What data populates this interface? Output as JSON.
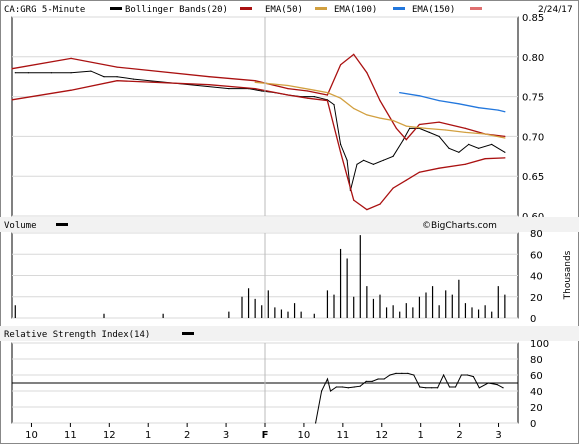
{
  "header": {
    "symbol_label": "CA:GRG 5-Minute",
    "legend": [
      {
        "label": "Bollinger Bands(20)",
        "color": "#000000",
        "swatch": "black-bar"
      },
      {
        "label": "EMA(50)",
        "color": "#aa1111",
        "swatch": "red-bar"
      },
      {
        "label": "EMA(100)",
        "color": "#d2a040",
        "swatch": "gold-bar"
      },
      {
        "label": "EMA(150)",
        "color": "#2277dd",
        "swatch": "blue-bar"
      }
    ],
    "trailing_swatch_color": "#e07070",
    "date": "2/24/17"
  },
  "volume_panel": {
    "label": "Volume",
    "watermark": "©BigCharts.com",
    "unit": "Thousands"
  },
  "rsi_panel": {
    "label": "Relative Strength Index(14)"
  },
  "x_axis_labels": [
    "10",
    "11",
    "12",
    "1",
    "2",
    "3",
    "F",
    "10",
    "11",
    "12",
    "1",
    "2",
    "3"
  ],
  "chart_data": [
    {
      "type": "line",
      "title": "CA:GRG 5-Minute",
      "ylim": [
        0.6,
        0.85
      ],
      "y_ticks": [
        0.85,
        0.8,
        0.75,
        0.7,
        0.65,
        0.6
      ],
      "x": [
        0,
        1,
        2,
        3,
        4,
        5,
        6,
        7,
        8,
        9,
        10,
        11,
        12,
        13,
        14,
        15,
        16,
        17,
        18,
        19,
        20,
        21,
        22,
        23,
        24,
        25,
        26,
        27,
        28,
        29,
        30,
        31,
        32,
        33,
        34,
        35,
        36,
        37,
        38,
        39,
        40,
        41,
        42,
        43,
        44,
        45,
        46,
        47,
        48,
        49,
        50,
        51,
        52,
        53,
        54,
        55,
        56,
        57,
        58,
        59,
        60,
        61,
        62,
        63,
        64,
        65,
        66,
        67,
        68,
        69,
        70,
        71,
        72,
        73,
        74,
        75,
        76,
        77,
        78,
        79,
        80,
        81,
        82,
        83,
        84,
        85,
        86,
        87,
        88,
        89,
        90,
        91,
        92,
        93,
        94,
        95,
        96,
        97,
        98,
        99,
        100,
        101,
        102,
        103,
        104,
        105,
        106,
        107,
        108,
        109,
        110,
        111,
        112,
        113,
        114,
        115,
        116,
        117,
        118,
        119,
        120,
        121,
        122,
        123,
        124,
        125,
        126,
        127,
        128,
        129,
        130,
        131,
        132,
        133,
        134,
        135,
        136,
        137,
        138,
        139,
        140,
        141,
        142,
        143,
        144,
        145,
        146,
        147,
        148,
        149,
        150,
        151,
        152,
        153,
        154
      ],
      "series": [
        {
          "name": "Price",
          "color": "#000000",
          "points": [
            [
              1,
              0.78
            ],
            [
              5,
              0.78
            ],
            [
              12,
              0.78
            ],
            [
              18,
              0.78
            ],
            [
              24,
              0.782
            ],
            [
              28,
              0.775
            ],
            [
              32,
              0.775
            ],
            [
              37,
              0.772
            ],
            [
              66,
              0.76
            ],
            [
              72,
              0.76
            ],
            [
              76,
              0.757
            ],
            [
              80,
              0.755
            ],
            [
              84,
              0.752
            ],
            [
              88,
              0.75
            ],
            [
              92,
              0.75
            ],
            [
              96,
              0.746
            ],
            [
              98,
              0.74
            ],
            [
              100,
              0.69
            ],
            [
              102,
              0.67
            ],
            [
              103,
              0.632
            ],
            [
              105,
              0.665
            ],
            [
              107,
              0.67
            ],
            [
              110,
              0.665
            ],
            [
              113,
              0.67
            ],
            [
              116,
              0.675
            ],
            [
              119,
              0.695
            ],
            [
              121,
              0.71
            ],
            [
              124,
              0.71
            ],
            [
              127,
              0.705
            ],
            [
              130,
              0.7
            ],
            [
              133,
              0.685
            ],
            [
              136,
              0.68
            ],
            [
              139,
              0.69
            ],
            [
              142,
              0.685
            ],
            [
              146,
              0.69
            ],
            [
              150,
              0.68
            ]
          ]
        },
        {
          "name": "Bollinger Upper",
          "color": "#aa1111",
          "points": [
            [
              0,
              0.785
            ],
            [
              18,
              0.798
            ],
            [
              32,
              0.787
            ],
            [
              60,
              0.775
            ],
            [
              74,
              0.77
            ],
            [
              84,
              0.76
            ],
            [
              90,
              0.757
            ],
            [
              96,
              0.752
            ],
            [
              100,
              0.79
            ],
            [
              104,
              0.803
            ],
            [
              108,
              0.78
            ],
            [
              112,
              0.745
            ],
            [
              117,
              0.71
            ],
            [
              120,
              0.696
            ],
            [
              124,
              0.715
            ],
            [
              130,
              0.718
            ],
            [
              138,
              0.71
            ],
            [
              144,
              0.703
            ],
            [
              150,
              0.7
            ]
          ]
        },
        {
          "name": "Bollinger Lower",
          "color": "#aa1111",
          "points": [
            [
              0,
              0.746
            ],
            [
              18,
              0.758
            ],
            [
              32,
              0.77
            ],
            [
              60,
              0.765
            ],
            [
              74,
              0.76
            ],
            [
              84,
              0.752
            ],
            [
              90,
              0.748
            ],
            [
              96,
              0.745
            ],
            [
              100,
              0.68
            ],
            [
              104,
              0.62
            ],
            [
              108,
              0.608
            ],
            [
              112,
              0.615
            ],
            [
              116,
              0.635
            ],
            [
              120,
              0.645
            ],
            [
              124,
              0.655
            ],
            [
              130,
              0.66
            ],
            [
              138,
              0.665
            ],
            [
              144,
              0.672
            ],
            [
              150,
              0.673
            ]
          ]
        },
        {
          "name": "EMA(100)",
          "color": "#d2a040",
          "points": [
            [
              74,
              0.768
            ],
            [
              84,
              0.764
            ],
            [
              92,
              0.758
            ],
            [
              96,
              0.755
            ],
            [
              100,
              0.748
            ],
            [
              104,
              0.735
            ],
            [
              108,
              0.727
            ],
            [
              112,
              0.723
            ],
            [
              116,
              0.72
            ],
            [
              120,
              0.713
            ],
            [
              126,
              0.71
            ],
            [
              132,
              0.708
            ],
            [
              138,
              0.705
            ],
            [
              144,
              0.703
            ],
            [
              150,
              0.698
            ]
          ]
        },
        {
          "name": "EMA(150)",
          "color": "#2277dd",
          "points": [
            [
              118,
              0.755
            ],
            [
              124,
              0.751
            ],
            [
              130,
              0.745
            ],
            [
              136,
              0.741
            ],
            [
              142,
              0.736
            ],
            [
              148,
              0.733
            ],
            [
              150,
              0.731
            ]
          ]
        }
      ]
    },
    {
      "type": "bar",
      "title": "Volume",
      "ylim": [
        0,
        80
      ],
      "y_ticks": [
        80,
        60,
        40,
        20,
        0
      ],
      "ylabel": "Thousands",
      "points": [
        [
          1,
          12
        ],
        [
          28,
          4
        ],
        [
          46,
          4
        ],
        [
          66,
          6
        ],
        [
          70,
          20
        ],
        [
          72,
          28
        ],
        [
          74,
          18
        ],
        [
          76,
          12
        ],
        [
          78,
          26
        ],
        [
          80,
          10
        ],
        [
          82,
          8
        ],
        [
          84,
          6
        ],
        [
          86,
          14
        ],
        [
          88,
          6
        ],
        [
          92,
          4
        ],
        [
          96,
          26
        ],
        [
          98,
          22
        ],
        [
          100,
          65
        ],
        [
          102,
          56
        ],
        [
          104,
          20
        ],
        [
          106,
          78
        ],
        [
          108,
          30
        ],
        [
          110,
          18
        ],
        [
          112,
          22
        ],
        [
          114,
          10
        ],
        [
          116,
          12
        ],
        [
          118,
          6
        ],
        [
          120,
          14
        ],
        [
          122,
          10
        ],
        [
          124,
          20
        ],
        [
          126,
          24
        ],
        [
          128,
          30
        ],
        [
          130,
          12
        ],
        [
          132,
          26
        ],
        [
          134,
          22
        ],
        [
          136,
          36
        ],
        [
          138,
          14
        ],
        [
          140,
          10
        ],
        [
          142,
          8
        ],
        [
          144,
          12
        ],
        [
          146,
          6
        ],
        [
          148,
          30
        ],
        [
          150,
          22
        ]
      ]
    },
    {
      "type": "line",
      "title": "Relative Strength Index(14)",
      "ylim": [
        0,
        100
      ],
      "y_ticks": [
        100,
        80,
        60,
        40,
        20,
        0
      ],
      "reference_line": 50,
      "points": [
        [
          102,
          0
        ],
        [
          104,
          40
        ],
        [
          106,
          55
        ],
        [
          107,
          40
        ],
        [
          109,
          45
        ],
        [
          111,
          45
        ],
        [
          113,
          44
        ],
        [
          115,
          45
        ],
        [
          117,
          46
        ],
        [
          119,
          52
        ],
        [
          121,
          52
        ],
        [
          123,
          55
        ],
        [
          125,
          55
        ],
        [
          127,
          60
        ],
        [
          129,
          62
        ],
        [
          131,
          62
        ],
        [
          133,
          62
        ],
        [
          135,
          60
        ],
        [
          137,
          45
        ],
        [
          139,
          44
        ],
        [
          141,
          44
        ],
        [
          143,
          44
        ],
        [
          145,
          60
        ],
        [
          147,
          45
        ],
        [
          149,
          45
        ],
        [
          151,
          60
        ],
        [
          153,
          60
        ],
        [
          155,
          58
        ],
        [
          157,
          44
        ],
        [
          160,
          50
        ],
        [
          163,
          48
        ],
        [
          165,
          44
        ]
      ]
    }
  ]
}
